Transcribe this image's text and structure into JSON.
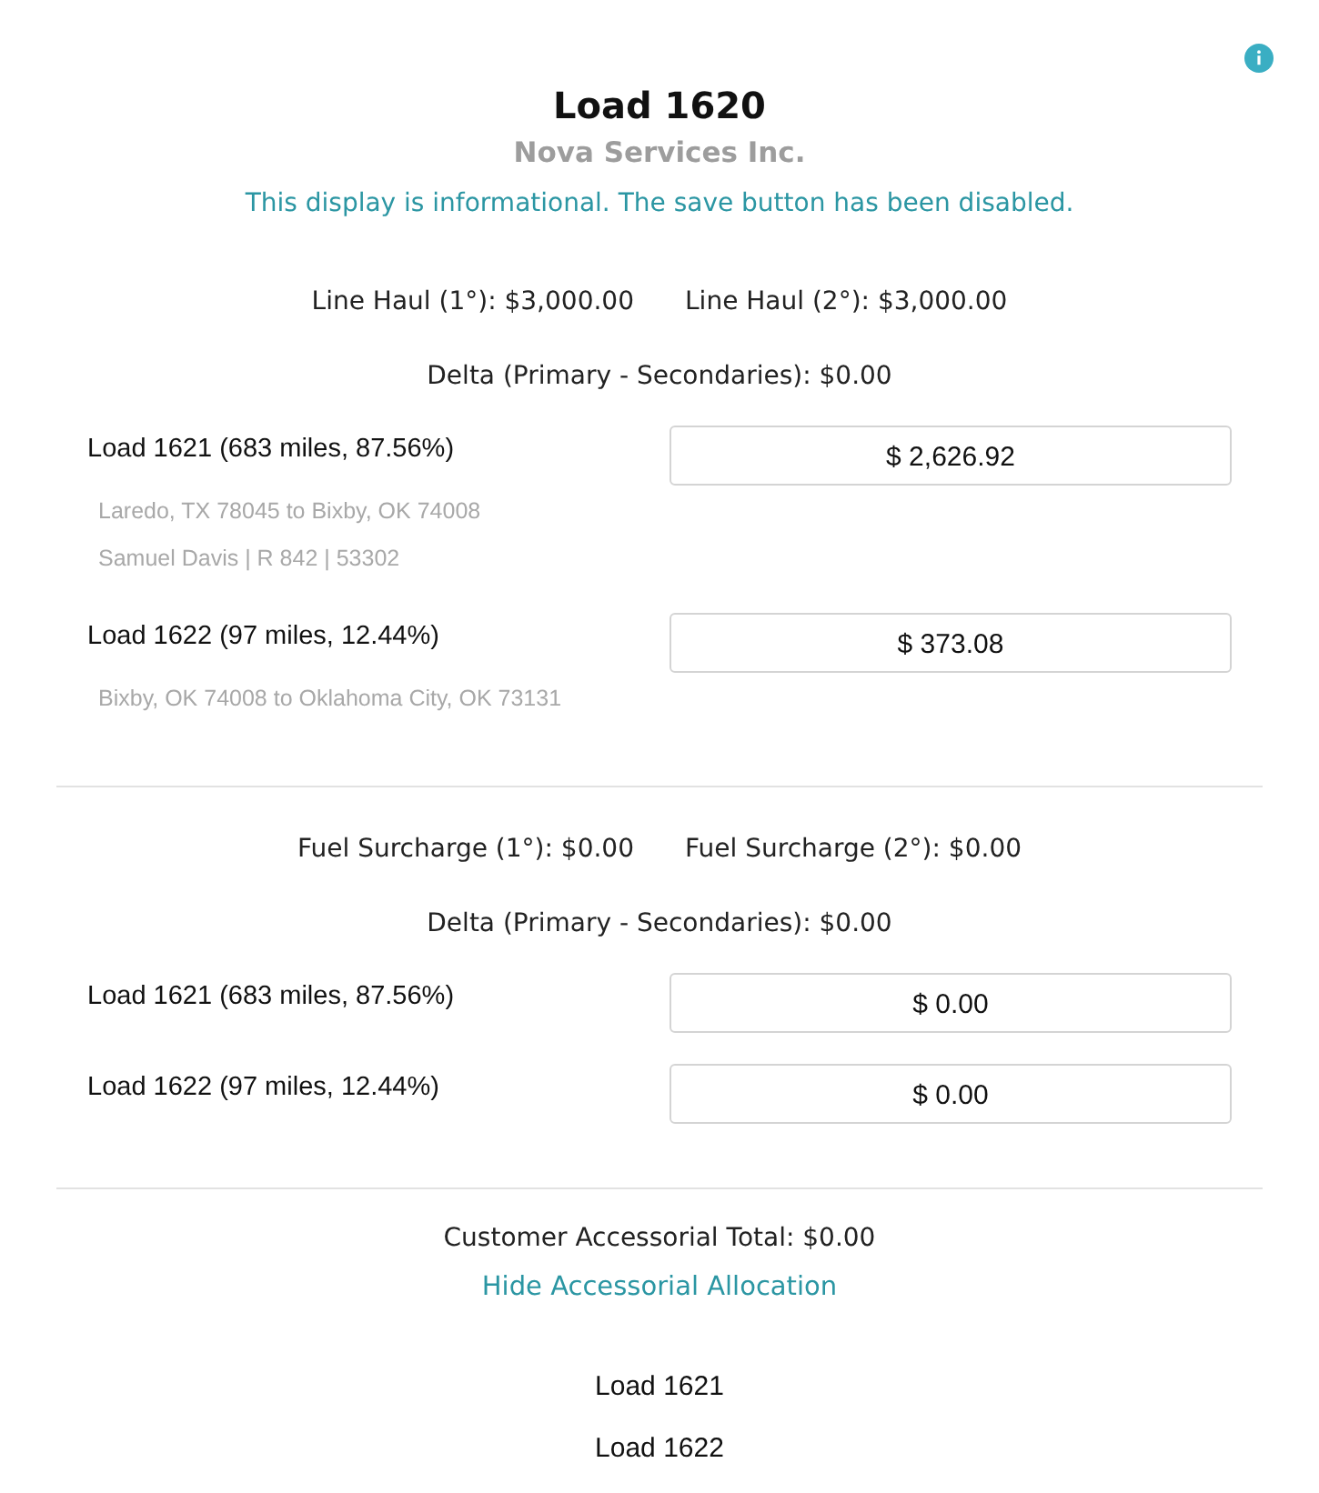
{
  "header": {
    "title": "Load 1620",
    "customer": "Nova Services Inc.",
    "notice": "This display is informational. The save button has been disabled."
  },
  "sections": [
    {
      "totals": [
        "Line Haul (1°): $3,000.00",
        "Line Haul (2°): $3,000.00"
      ],
      "delta": "Delta (Primary - Secondaries): $0.00",
      "loads": [
        {
          "label": "Load 1621 (683 miles, 87.56%)",
          "details": [
            "Laredo, TX 78045 to Bixby, OK 74008",
            "Samuel Davis | R 842 | 53302"
          ],
          "amount": "$ 2,626.92"
        },
        {
          "label": "Load 1622 (97 miles, 12.44%)",
          "details": [
            "Bixby, OK 74008 to Oklahoma City, OK 73131"
          ],
          "amount": "$ 373.08"
        }
      ]
    },
    {
      "totals": [
        "Fuel Surcharge (1°): $0.00",
        "Fuel Surcharge (2°): $0.00"
      ],
      "delta": "Delta (Primary - Secondaries): $0.00",
      "loads": [
        {
          "label": "Load 1621 (683 miles, 87.56%)",
          "amount": "$ 0.00"
        },
        {
          "label": "Load 1622 (97 miles, 12.44%)",
          "amount": "$ 0.00"
        }
      ]
    }
  ],
  "accessorials": {
    "total": "Customer Accessorial Total: $0.00",
    "toggle_link": "Hide Accessorial Allocation",
    "loads": [
      "Load 1621",
      "Load 1622"
    ]
  }
}
